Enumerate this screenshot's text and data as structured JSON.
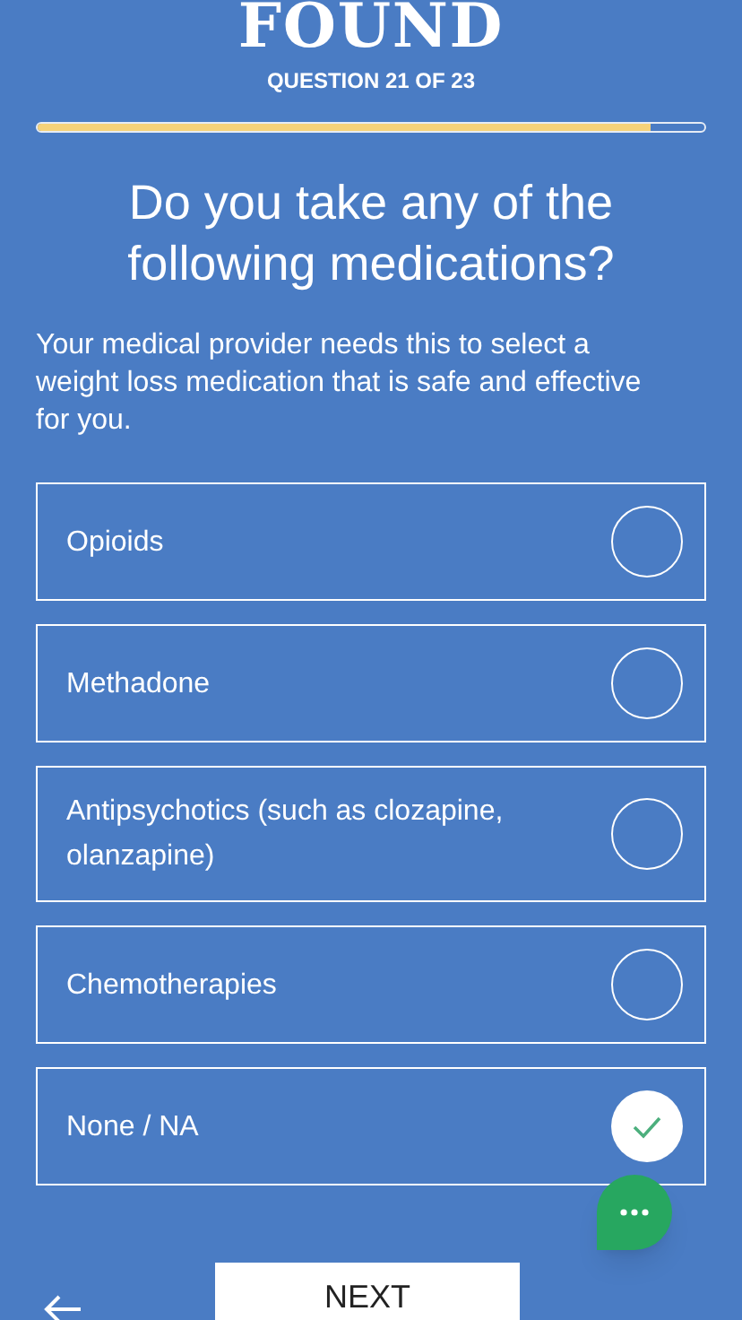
{
  "brand": "FOUND",
  "progress": {
    "label": "QUESTION 21 OF 23",
    "level": 0.92
  },
  "question": "Do you take any of the following medications?",
  "description": "Your medical provider needs this to select a weight loss medication that is safe and effective for you.",
  "options": [
    {
      "label": "Opioids",
      "selected": false
    },
    {
      "label": "Methadone",
      "selected": false
    },
    {
      "label": "Antipsychotics (such as clozapine, olanzapine)",
      "selected": false
    },
    {
      "label": "Chemotherapies",
      "selected": false
    },
    {
      "label": "None / NA",
      "selected": true
    }
  ],
  "next_button": "NEXT"
}
